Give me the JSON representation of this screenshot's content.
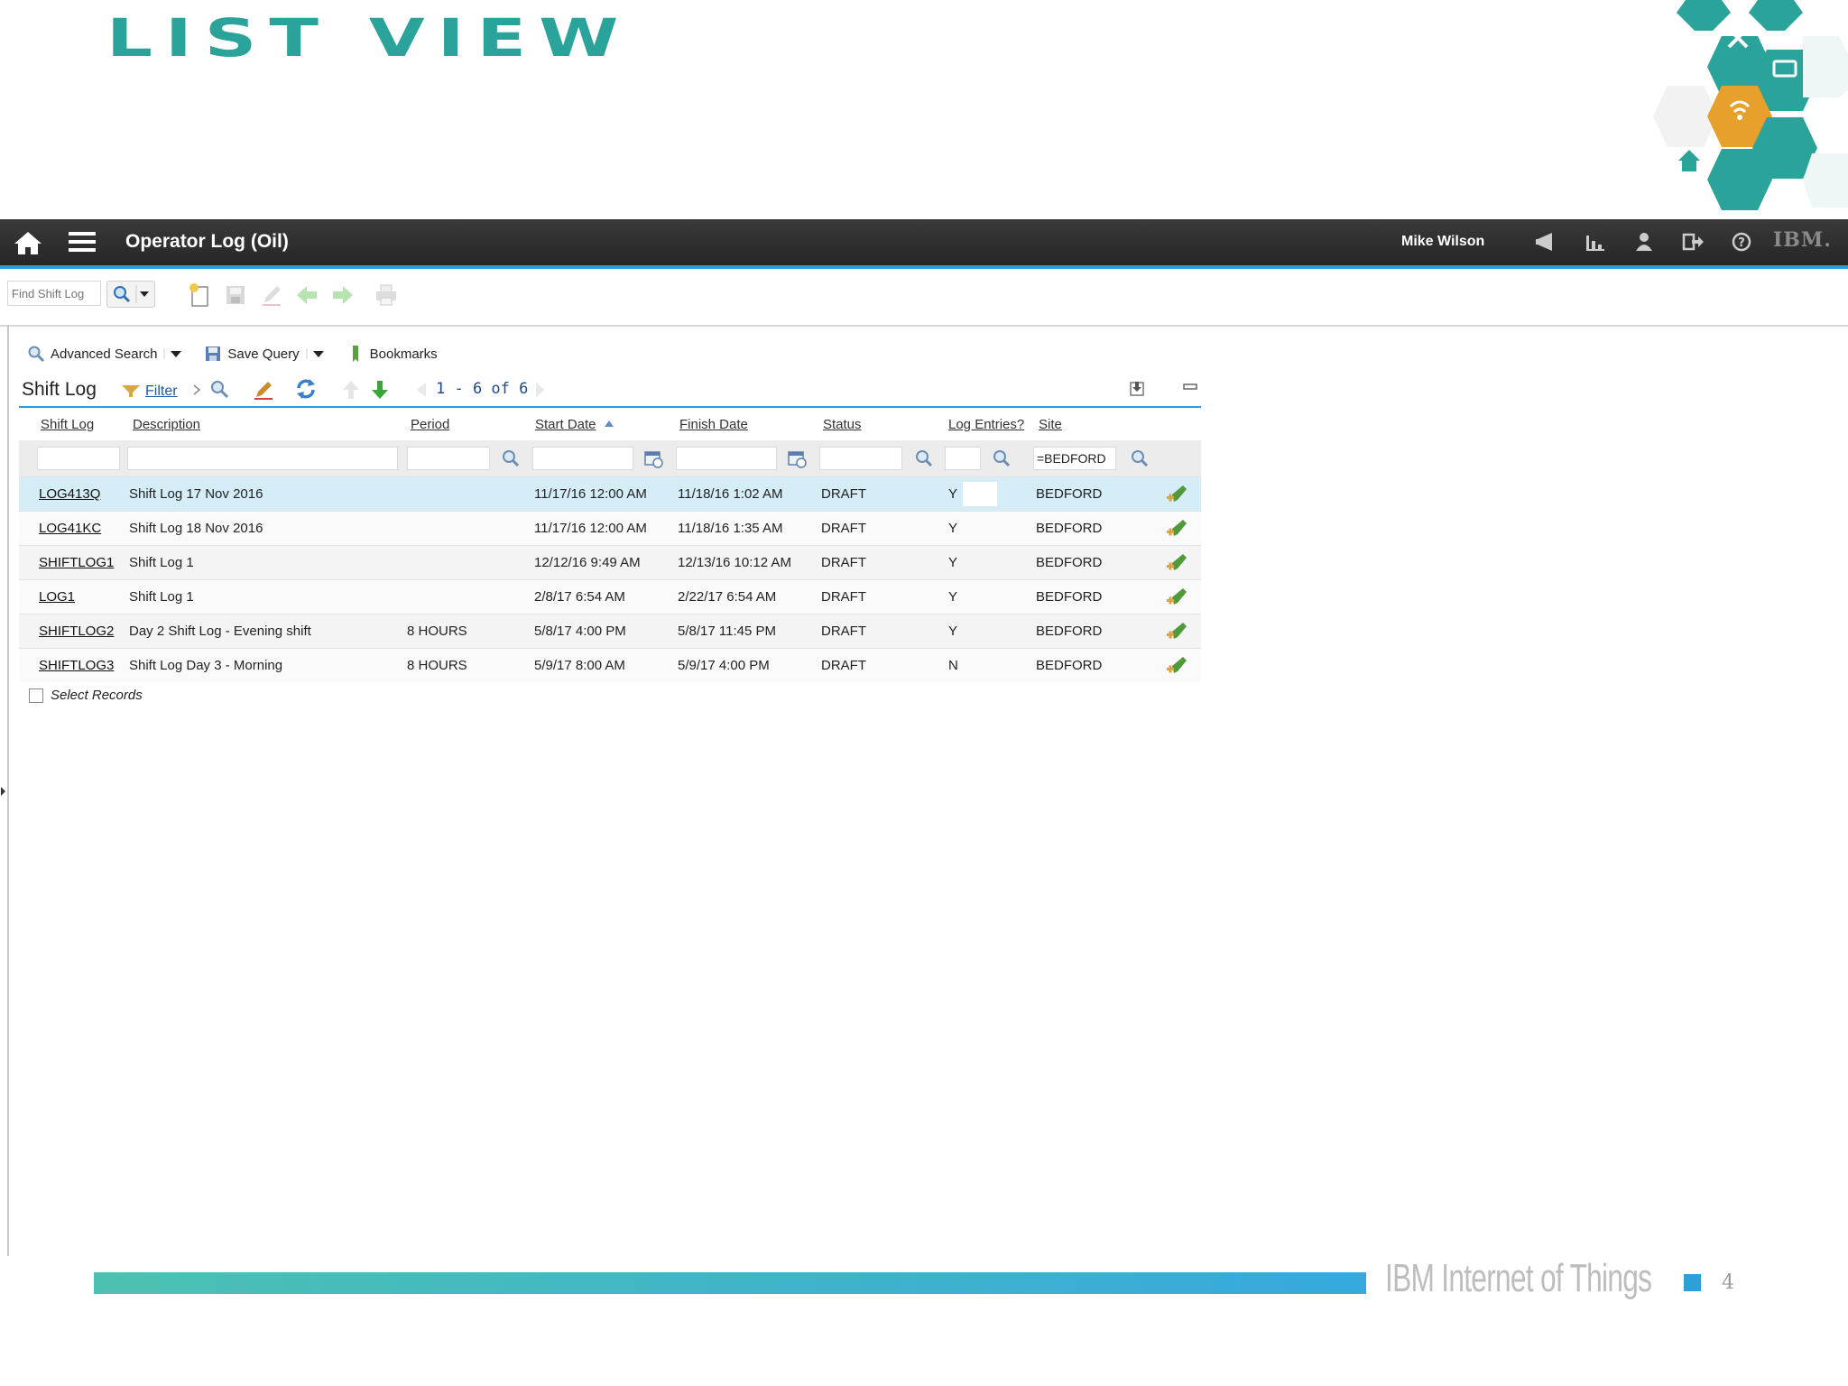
{
  "slide": {
    "title": "LIST VIEW",
    "footer_brand": "IBM Internet of Things",
    "page_number": "4",
    "accent_colors": {
      "teal": "#2aa39a",
      "blue": "#2d9bd2",
      "orange": "#e7a02b"
    }
  },
  "navbar": {
    "app_title": "Operator Log (Oil)",
    "user_name": "Mike Wilson",
    "logo_text": "IBM.",
    "icons": [
      "home-icon",
      "menu-icon",
      "megaphone-icon",
      "chart-icon",
      "profile-icon",
      "signout-icon",
      "help-icon"
    ]
  },
  "toolbar": {
    "find_placeholder": "Find Shift Log",
    "icons": [
      "search-icon",
      "dropdown-icon",
      "new-record-icon",
      "save-icon",
      "edit-icon",
      "previous-icon",
      "next-icon",
      "print-icon"
    ]
  },
  "section": {
    "advanced_search": "Advanced Search",
    "save_query": "Save Query",
    "bookmarks": "Bookmarks"
  },
  "table": {
    "title": "Shift Log",
    "filter_label": "Filter",
    "paging": "1 - 6 of 6",
    "columns": [
      "Shift Log",
      "Description",
      "Period",
      "Start Date",
      "Finish Date",
      "Status",
      "Log Entries?",
      "Site"
    ],
    "sorted_column": "Start Date",
    "filters": {
      "site": "=BEDFORD"
    },
    "rows": [
      {
        "log": "LOG413Q",
        "description": "Shift Log 17 Nov 2016",
        "period": "",
        "start": "11/17/16 12:00 AM",
        "finish": "11/18/16 1:02 AM",
        "status": "DRAFT",
        "entries": "Y",
        "site": "BEDFORD"
      },
      {
        "log": "LOG41KC",
        "description": "Shift Log 18 Nov 2016",
        "period": "",
        "start": "11/17/16 12:00 AM",
        "finish": "11/18/16 1:35 AM",
        "status": "DRAFT",
        "entries": "Y",
        "site": "BEDFORD"
      },
      {
        "log": "SHIFTLOG1",
        "description": "Shift Log 1",
        "period": "",
        "start": "12/12/16 9:49 AM",
        "finish": "12/13/16 10:12 AM",
        "status": "DRAFT",
        "entries": "Y",
        "site": "BEDFORD"
      },
      {
        "log": "LOG1",
        "description": "Shift Log 1",
        "period": "",
        "start": "2/8/17 6:54 AM",
        "finish": "2/22/17 6:54 AM",
        "status": "DRAFT",
        "entries": "Y",
        "site": "BEDFORD"
      },
      {
        "log": "SHIFTLOG2",
        "description": "Day 2 Shift Log - Evening shift",
        "period": "8 HOURS",
        "start": "5/8/17 4:00 PM",
        "finish": "5/8/17 11:45 PM",
        "status": "DRAFT",
        "entries": "Y",
        "site": "BEDFORD"
      },
      {
        "log": "SHIFTLOG3",
        "description": "Shift Log Day 3 - Morning",
        "period": "8 HOURS",
        "start": "5/9/17 8:00 AM",
        "finish": "5/9/17 4:00 PM",
        "status": "DRAFT",
        "entries": "N",
        "site": "BEDFORD"
      }
    ],
    "select_records": "Select Records"
  }
}
